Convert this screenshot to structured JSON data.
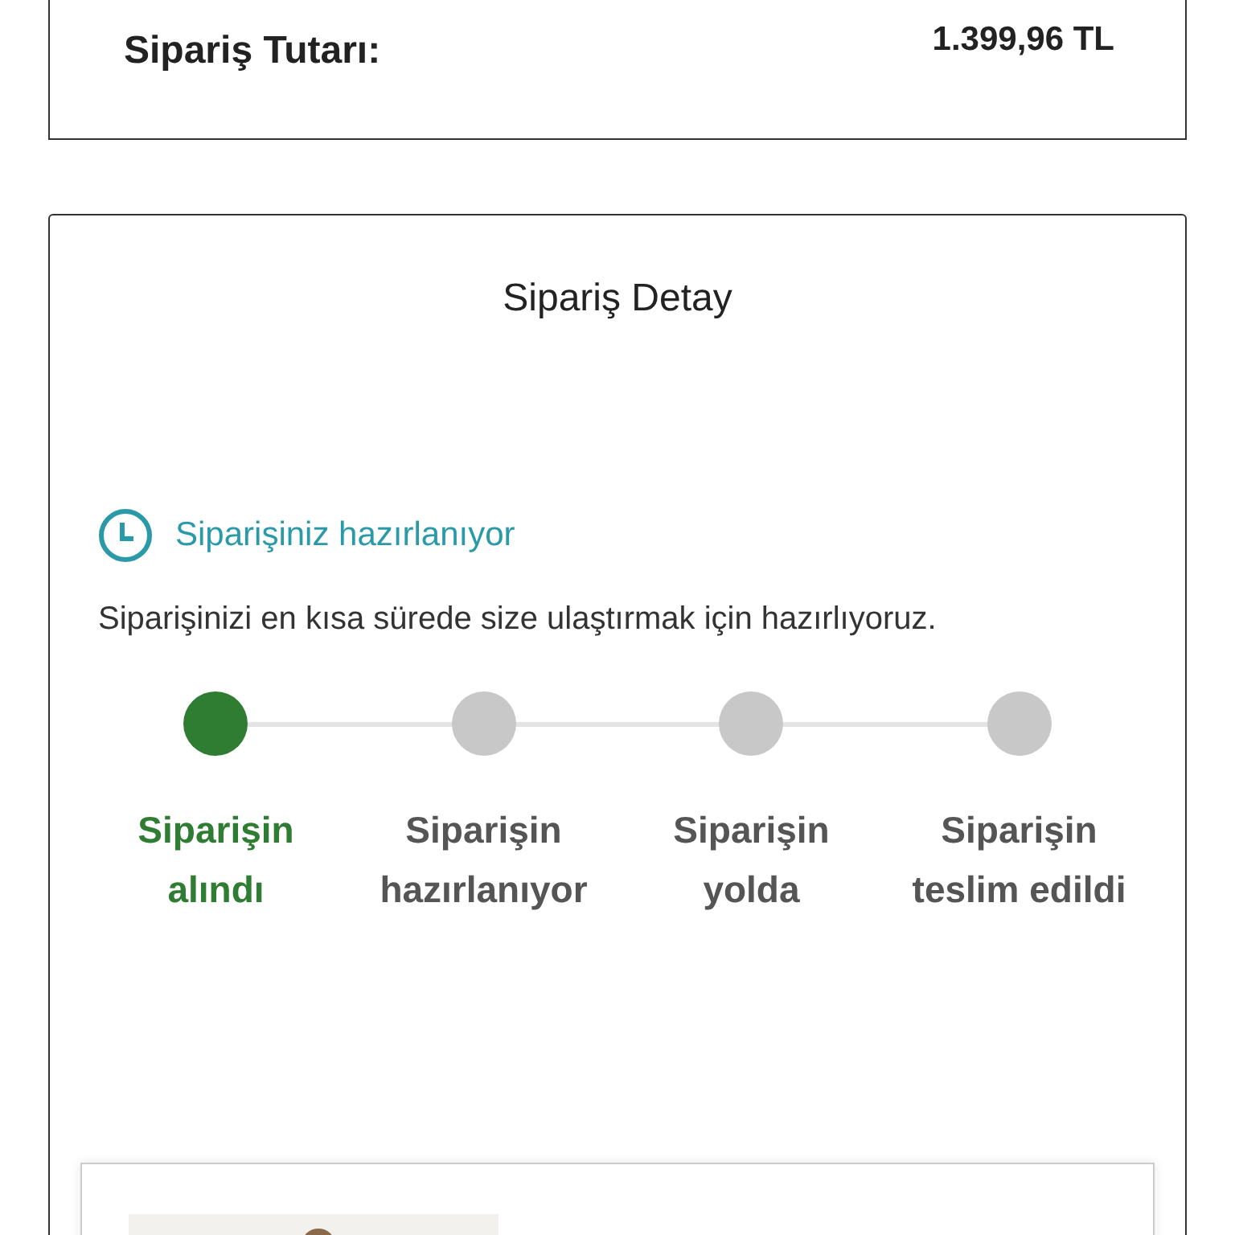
{
  "order_total": {
    "label": "Sipariş Tutarı:",
    "value": "1.399,96 TL"
  },
  "order_detail": {
    "title": "Sipariş Detay",
    "status": {
      "label": "Siparişiniz hazırlanıyor",
      "description": "Siparişinizi en kısa sürede size ulaştırmak için hazırlıyoruz."
    },
    "steps": [
      {
        "label": "Siparişin alındı",
        "done": true
      },
      {
        "label": "Siparişin hazırlanıyor",
        "done": false
      },
      {
        "label": "Siparişin yolda",
        "done": false
      },
      {
        "label": "Siparişin teslim edildi",
        "done": false
      }
    ]
  }
}
